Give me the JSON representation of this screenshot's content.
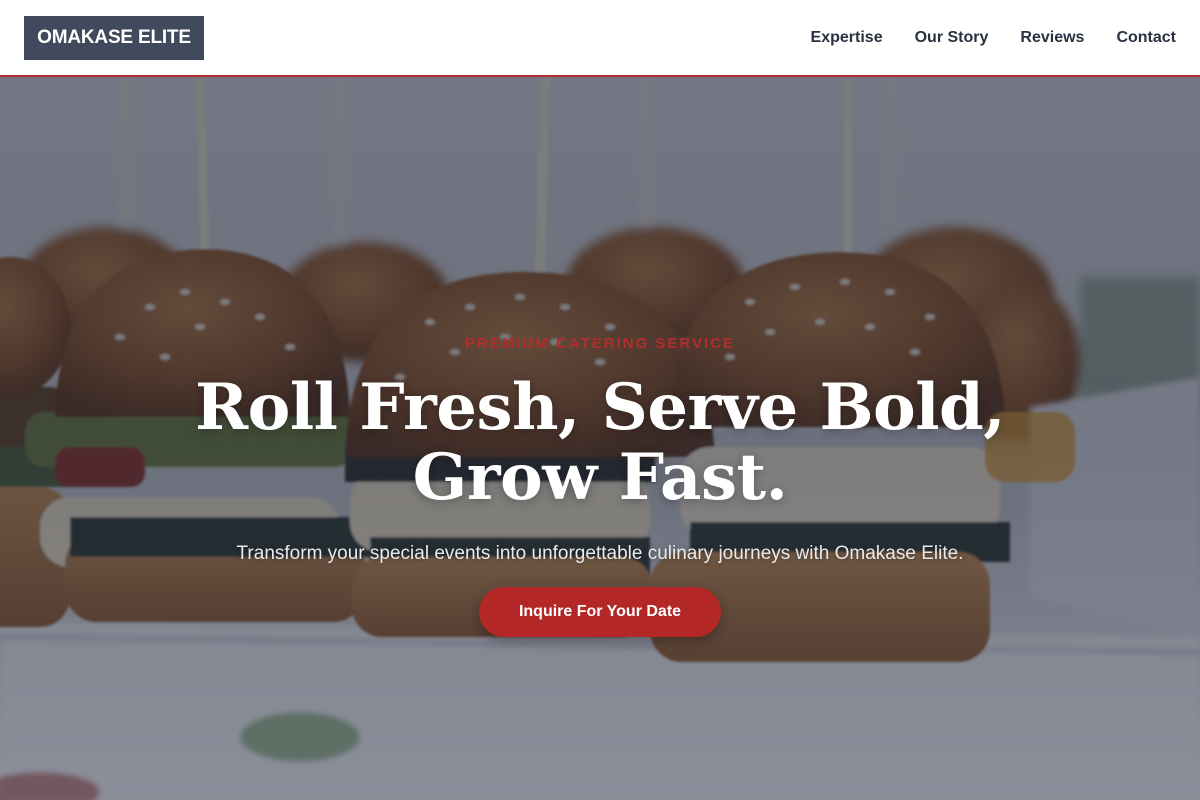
{
  "header": {
    "logo_text": "OMAKASE ELITE",
    "nav": [
      {
        "label": "Expertise"
      },
      {
        "label": "Our Story"
      },
      {
        "label": "Reviews"
      },
      {
        "label": "Contact"
      }
    ]
  },
  "hero": {
    "eyebrow": "PREMIUM CATERING SERVICE",
    "headline_line1": "Roll Fresh, Serve Bold,",
    "headline_line2": "Grow Fast.",
    "subtext": "Transform your special events into unforgettable culinary journeys with Omakase Elite.",
    "cta_label": "Inquire For Your Date",
    "background_image": "sliders-on-skewers-photo"
  },
  "colors": {
    "accent": "#b42727",
    "logo_bg": "#404a5c",
    "nav_text": "#2a3140",
    "header_border": "#b32d2d"
  }
}
